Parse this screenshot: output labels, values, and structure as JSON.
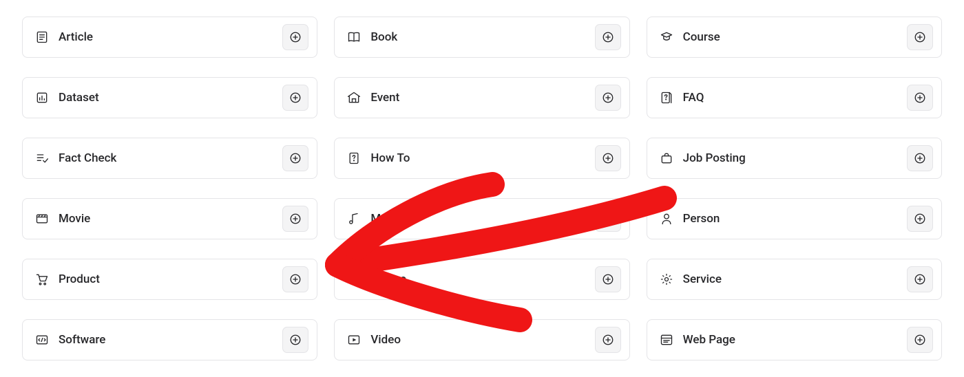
{
  "items": [
    {
      "label": "Article",
      "icon": "article-icon",
      "slug": "article"
    },
    {
      "label": "Book",
      "icon": "book-icon",
      "slug": "book"
    },
    {
      "label": "Course",
      "icon": "course-icon",
      "slug": "course"
    },
    {
      "label": "Dataset",
      "icon": "dataset-icon",
      "slug": "dataset"
    },
    {
      "label": "Event",
      "icon": "event-icon",
      "slug": "event"
    },
    {
      "label": "FAQ",
      "icon": "faq-icon",
      "slug": "faq"
    },
    {
      "label": "Fact Check",
      "icon": "fact-check-icon",
      "slug": "fact-check"
    },
    {
      "label": "How To",
      "icon": "how-to-icon",
      "slug": "how-to"
    },
    {
      "label": "Job Posting",
      "icon": "job-posting-icon",
      "slug": "job-posting"
    },
    {
      "label": "Movie",
      "icon": "movie-icon",
      "slug": "movie"
    },
    {
      "label": "Music",
      "icon": "music-icon",
      "slug": "music"
    },
    {
      "label": "Person",
      "icon": "person-icon",
      "slug": "person"
    },
    {
      "label": "Product",
      "icon": "product-icon",
      "slug": "product"
    },
    {
      "label": "Recipe",
      "icon": "recipe-icon",
      "slug": "recipe"
    },
    {
      "label": "Service",
      "icon": "service-icon",
      "slug": "service"
    },
    {
      "label": "Software",
      "icon": "software-icon",
      "slug": "software"
    },
    {
      "label": "Video",
      "icon": "video-icon",
      "slug": "video"
    },
    {
      "label": "Web Page",
      "icon": "web-page-icon",
      "slug": "web-page"
    }
  ],
  "annotation": {
    "type": "arrow",
    "color": "#ef1616",
    "target_item_index": 13,
    "target_label": "Recipe"
  }
}
